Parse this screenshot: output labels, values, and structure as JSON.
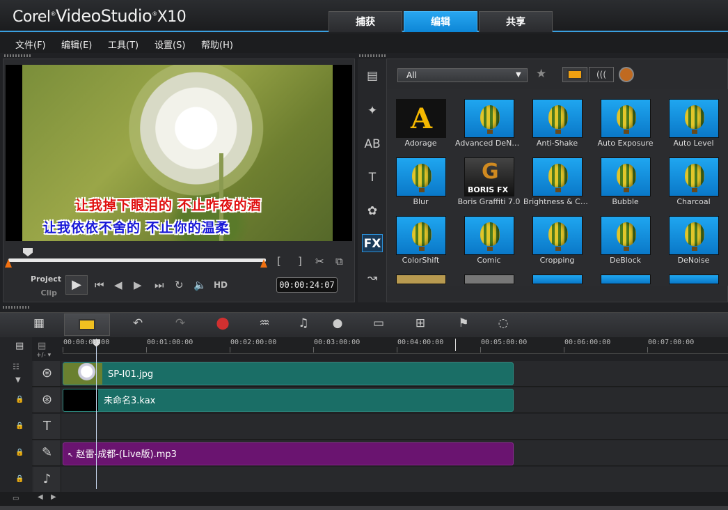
{
  "app": {
    "brand_left": "Corel",
    "brand_right": "VideoStudio",
    "brand_version": "X10"
  },
  "tabs": [
    {
      "label": "捕获"
    },
    {
      "label": "编辑",
      "active": true
    },
    {
      "label": "共享"
    }
  ],
  "menu": [
    {
      "label": "文件(F)"
    },
    {
      "label": "编辑(E)"
    },
    {
      "label": "工具(T)"
    },
    {
      "label": "设置(S)"
    },
    {
      "label": "帮助(H)"
    }
  ],
  "preview": {
    "subtitle_line1": "让我掉下眼泪的 不止昨夜的酒",
    "subtitle_line2": "让我依依不舍的 不止你的温柔",
    "mode_project": "Project",
    "mode_clip": "Clip",
    "hd_label": "HD",
    "timecode": "00:00:24:07"
  },
  "library": {
    "filter_value": "All",
    "effects": [
      {
        "name": "Adorage",
        "style": "adorage"
      },
      {
        "name": "Advanced DeNoise",
        "style": "balloon"
      },
      {
        "name": "Anti-Shake",
        "style": "balloon"
      },
      {
        "name": "Auto Exposure",
        "style": "balloon"
      },
      {
        "name": "Auto Level",
        "style": "balloon"
      },
      {
        "name": "Blur",
        "style": "balloon"
      },
      {
        "name": "Boris Graffiti 7.0",
        "style": "boris"
      },
      {
        "name": "Brightness & Contr...",
        "style": "balloon"
      },
      {
        "name": "Bubble",
        "style": "balloon"
      },
      {
        "name": "Charcoal",
        "style": "balloon"
      },
      {
        "name": "ColorShift",
        "style": "balloon"
      },
      {
        "name": "Comic",
        "style": "balloon"
      },
      {
        "name": "Cropping",
        "style": "balloon"
      },
      {
        "name": "DeBlock",
        "style": "balloon"
      },
      {
        "name": "DeNoise",
        "style": "balloon"
      }
    ]
  },
  "timeline": {
    "ruler": [
      "00:00:00:00",
      "00:01:00:00",
      "00:02:00:00",
      "00:03:00:00",
      "00:04:00:00",
      "00:05:00:00",
      "00:06:00:00",
      "00:07:00:00"
    ],
    "clips": {
      "video": "SP-I01.jpg",
      "overlay": "未命名3.kax",
      "audio": "赵雷-成都-(Live版).mp3"
    }
  },
  "colors": {
    "accent": "#1a9ae6",
    "clip_teal": "#1a6e66",
    "clip_purple": "#6a1470",
    "trim_orange": "#f07010"
  }
}
